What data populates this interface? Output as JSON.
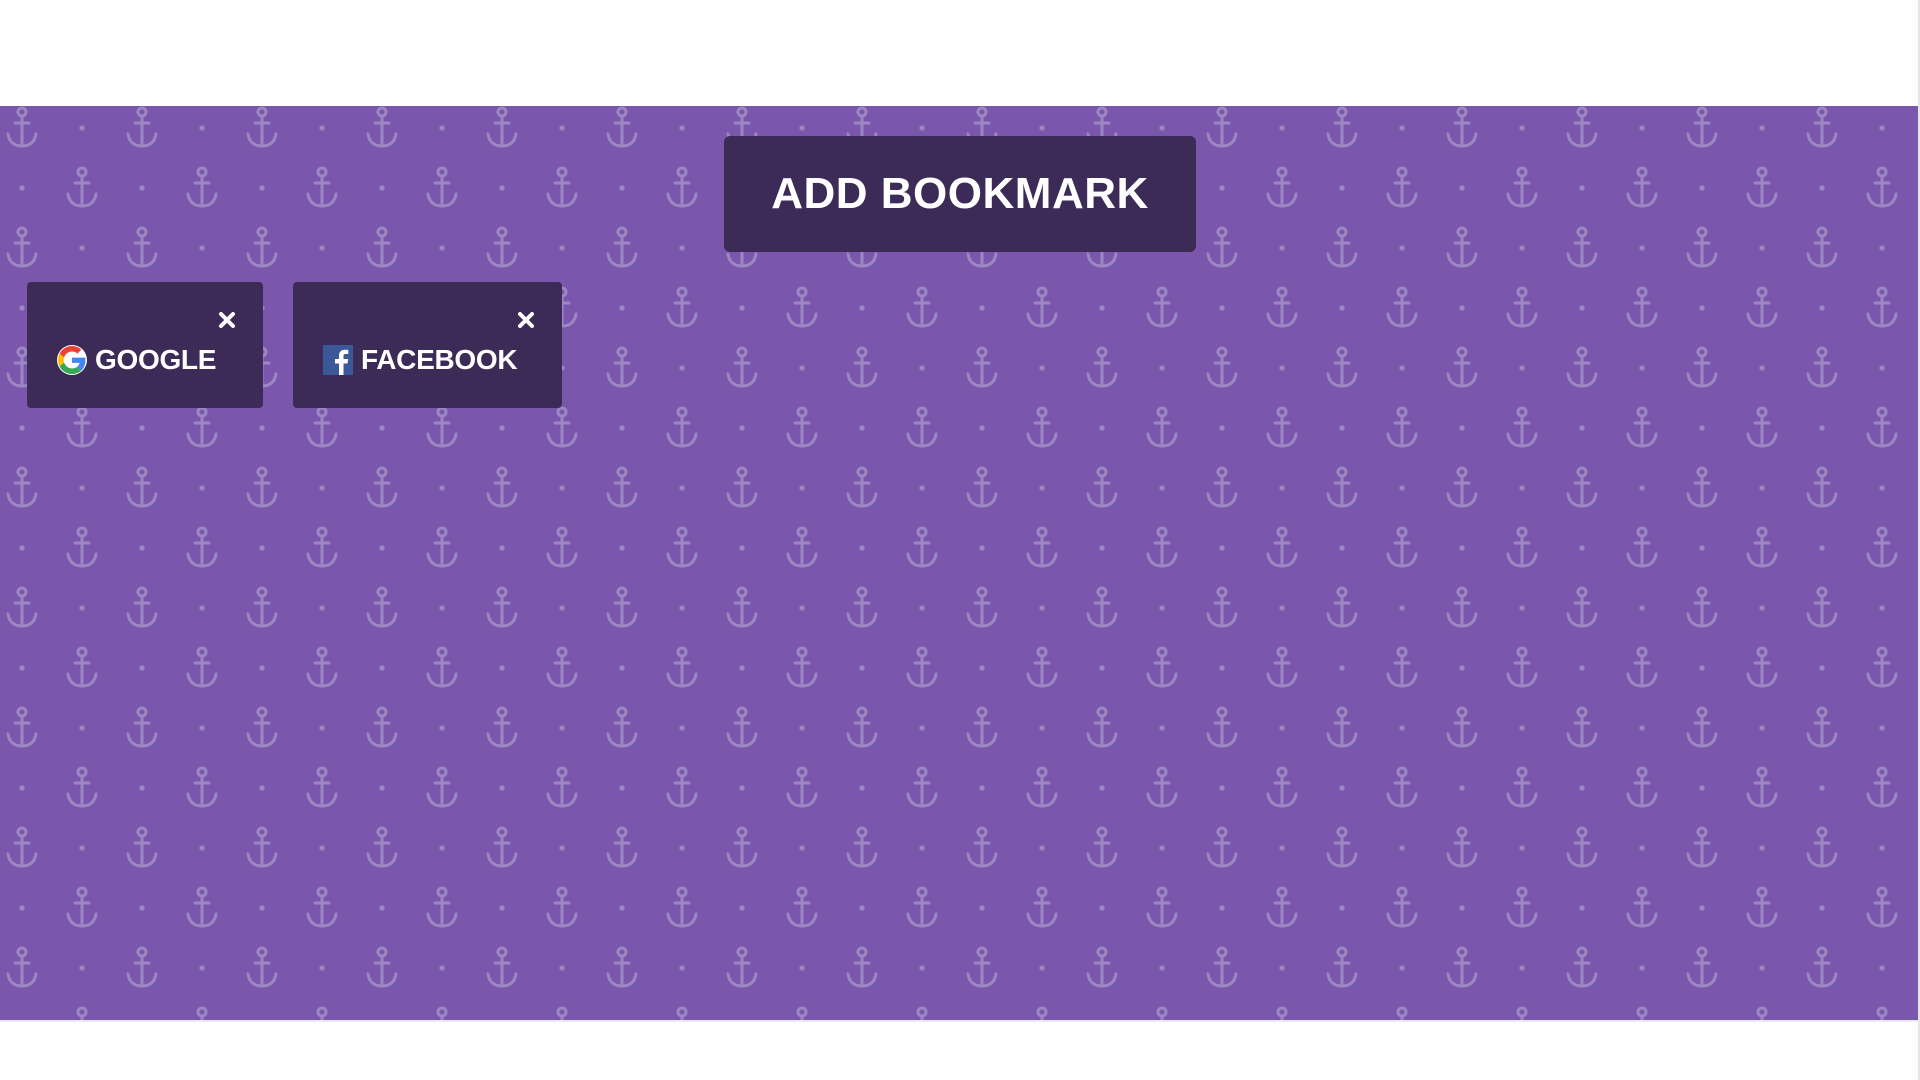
{
  "header": {},
  "main": {
    "add_bookmark_label": "ADD BOOKMARK",
    "background_color": "#7a57ad",
    "card_color": "#3c2b57",
    "pattern_icon": "anchor-icon",
    "bookmarks": [
      {
        "label": "GOOGLE",
        "favicon": "google-g-icon",
        "close_icon": "close-icon"
      },
      {
        "label": "FACEBOOK",
        "favicon": "facebook-f-icon",
        "close_icon": "close-icon"
      }
    ]
  }
}
